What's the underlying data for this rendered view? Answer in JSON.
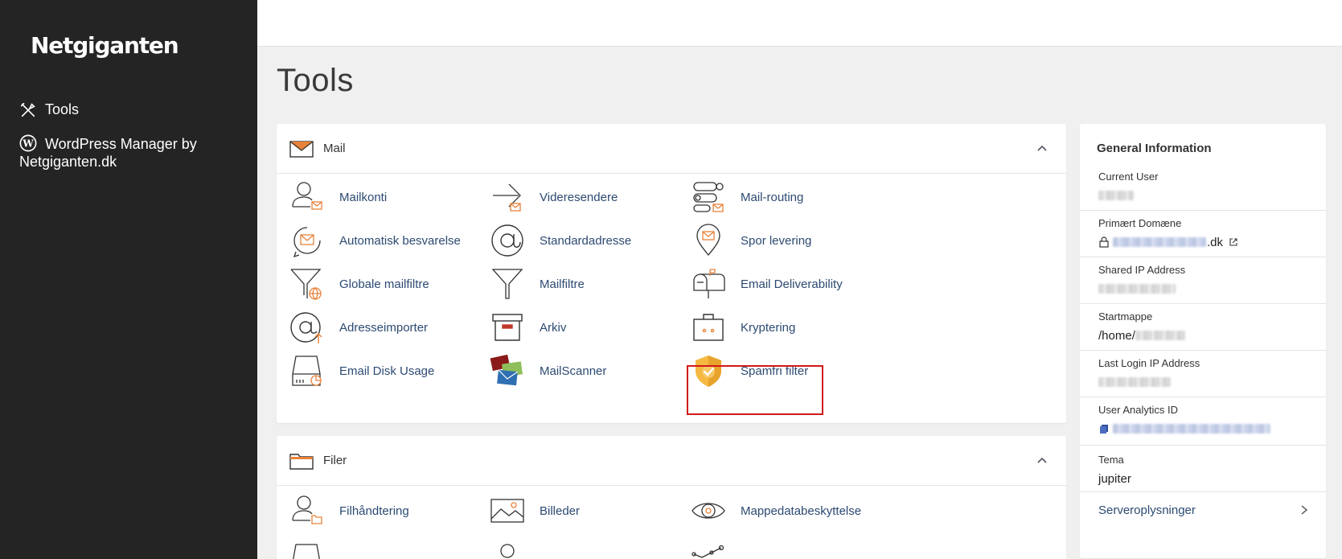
{
  "brand": {
    "logo": "Netgiganten"
  },
  "sidebar": {
    "items": [
      {
        "label": "Tools",
        "icon": "tools-icon"
      },
      {
        "label_line1": "WordPress Manager by",
        "label_line2": "Netgiganten.dk",
        "icon": "wordpress-icon"
      }
    ]
  },
  "page": {
    "title": "Tools"
  },
  "mail": {
    "title": "Mail",
    "tools": [
      {
        "label": "Mailkonti",
        "icon": "user-mail-icon"
      },
      {
        "label": "Videresendere",
        "icon": "forward-arrow-icon"
      },
      {
        "label": "Mail-routing",
        "icon": "routing-icon"
      },
      {
        "label": "Automatisk besvarelse",
        "icon": "autoresponder-icon"
      },
      {
        "label": "Standardadresse",
        "icon": "at-sign-icon"
      },
      {
        "label": "Spor levering",
        "icon": "map-pin-mail-icon"
      },
      {
        "label": "Globale mailfiltre",
        "icon": "global-filter-icon"
      },
      {
        "label": "Mailfiltre",
        "icon": "filter-funnel-icon"
      },
      {
        "label": "Email Deliverability",
        "icon": "mailbox-icon"
      },
      {
        "label": "Adresseimporter",
        "icon": "at-import-icon"
      },
      {
        "label": "Arkiv",
        "icon": "archive-box-icon"
      },
      {
        "label": "Kryptering",
        "icon": "encryption-briefcase-icon"
      },
      {
        "label": "Email Disk Usage",
        "icon": "disk-usage-icon"
      },
      {
        "label": "MailScanner",
        "icon": "mailscanner-envelopes-icon"
      },
      {
        "label": "Spamfri filter",
        "icon": "shield-check-icon"
      }
    ]
  },
  "files": {
    "title": "Filer",
    "tools": [
      {
        "label": "Filhåndtering",
        "icon": "user-folder-icon"
      },
      {
        "label": "Billeder",
        "icon": "image-icon"
      },
      {
        "label": "Mappedatabeskyttelse",
        "icon": "eye-icon"
      }
    ]
  },
  "info": {
    "title": "General Information",
    "current_user_label": "Current User",
    "primary_domain_label": "Primært Domæne",
    "primary_domain_suffix": ".dk",
    "shared_ip_label": "Shared IP Address",
    "startmappe_label": "Startmappe",
    "startmappe_prefix": "/home/",
    "last_login_label": "Last Login IP Address",
    "analytics_label": "User Analytics ID",
    "tema_label": "Tema",
    "tema_value": "jupiter",
    "server_link": "Serveroplysninger"
  },
  "colors": {
    "sidebar_bg": "#242424",
    "accent": "#e8823a",
    "link": "#2c4a72",
    "highlight": "#d11a1a",
    "shield": "#f5b942"
  }
}
